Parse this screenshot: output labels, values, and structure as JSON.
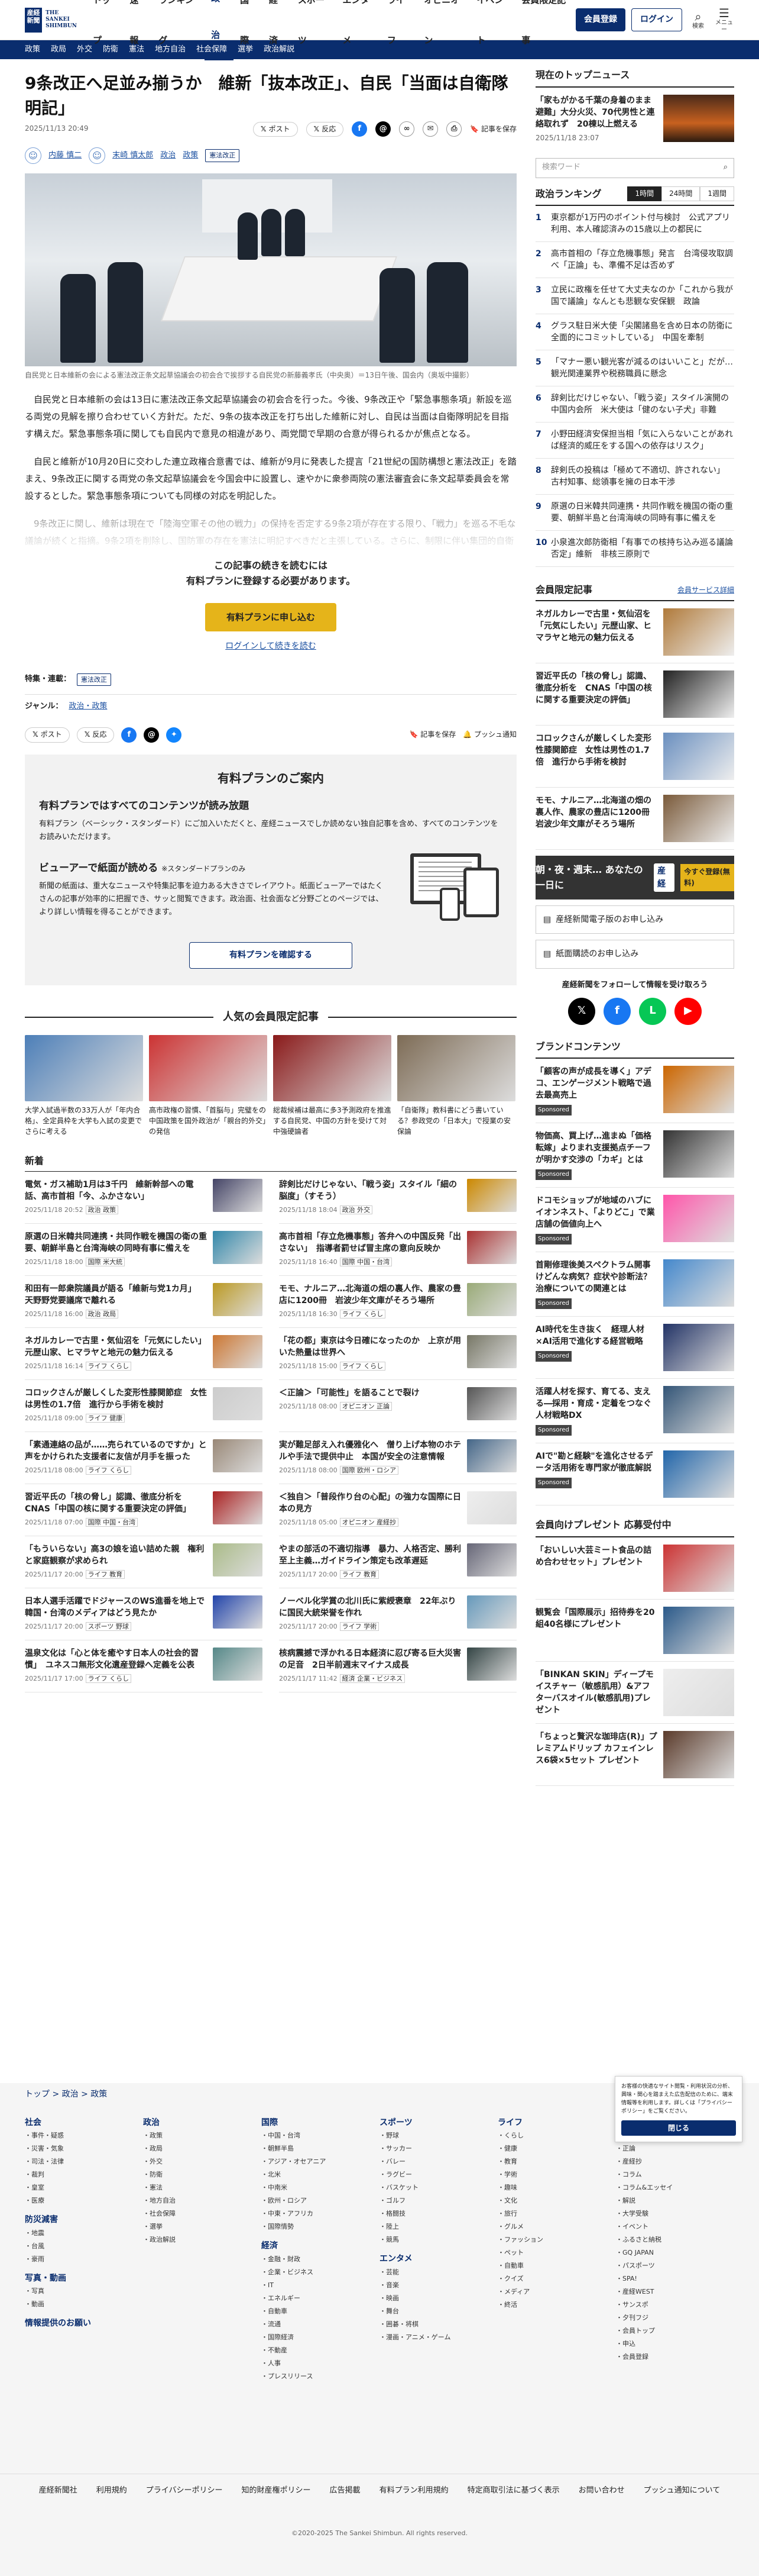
{
  "header": {
    "logo_top": "産経",
    "logo_bottom": "新聞",
    "logo_name_1": "THE",
    "logo_name_2": "SANKEI",
    "logo_name_3": "SHIMBUN",
    "nav": [
      "トップ",
      "速報",
      "ランキング",
      "政治",
      "国際",
      "経済",
      "スポーツ",
      "エンタメ",
      "ライフ",
      "オピニオン",
      "イベント",
      "会員限定記事"
    ],
    "register": "会員登録",
    "login": "ログイン",
    "search": "検索",
    "menu": "メニュー"
  },
  "subnav": [
    "政策",
    "政局",
    "外交",
    "防衛",
    "憲法",
    "地方自治",
    "社会保障",
    "選挙",
    "政治解説"
  ],
  "article": {
    "title": "9条改正へ足並み揃うか　維新「抜本改正」、自民「当面は自衛隊明記」",
    "time": "2025/11/13 20:49",
    "x_post": "ポスト",
    "reaction": "反応",
    "save": "記事を保存",
    "author1": "内藤 慎二",
    "author2": "末崎 慎太郎",
    "section": "政治",
    "section2": "政策",
    "tag": "憲法改正",
    "caption": "自民党と日本維新の会による憲法改正条文起草協議会の初会合で挨拶する自民党の新藤義孝氏（中央奥）＝13日午後、国会内（奥坂中撮影）",
    "p1": "自民党と日本維新の会は13日に憲法改正条文起草協議会の初会合を行った。今後、9条改正や「緊急事態条項」新設を巡る両党の見解を擦り合わせていく方針だ。ただ、9条の抜本改正を打ち出した維新に対し、自民は当面は自衛隊明記を目指す構えだ。緊急事態条項に関しても自民内で意見の相違があり、両党間で早期の合意が得られるかが焦点となる。",
    "p2": "自民と維新が10月20日に交わした連立政権合意書では、維新が9月に発表した提言「21世紀の国防構想と憲法改正」を踏まえ、9条改正に関する両党の条文起草協議会を今国会中に設置し、速やかに衆参両院の憲法審査会に条文起草委員会を常設するとした。緊急事態条項についても同様の対応を明記した。",
    "p3": "9条改正に関し、維新は現在で「陸海空軍その他の戦力」の保持を否定する9条2項が存在する限り、「戦力」を巡る不毛な議論が続くと指摘。9条2項を削除し、国防軍の存在を憲法に明記すべきだと主張している。さらに、制限に伴い集団的自衛権行使の全面容認に転換し、米国や豪州などの同盟国との連携強化を掲げる。",
    "paywall_1": "この記事の続きを読むには",
    "paywall_2": "有料プランに登録する必要があります。",
    "paywall_btn": "有料プランに申し込む",
    "paywall_login": "ログインして続きを読む",
    "special_label": "特集・連載：",
    "special": "憲法改正",
    "genre_label": "ジャンル：",
    "genre": "政治・政策",
    "push": "プッシュ通知"
  },
  "plan": {
    "title": "有料プランのご案内",
    "h1": "有料プランではすべてのコンテンツが読み放題",
    "d1": "有料プラン（ベーシック・スタンダード）にご加入いただくと、産経ニュースでしか読めない独自記事を含め、すべてのコンテンツをお読みいただけます。",
    "h2": "ビューアーで紙面が読める",
    "h2s": "※スタンダードプランのみ",
    "d2": "新聞の紙面は、重大なニュースや特集記事を迫力ある大きさでレイアウト。紙面ビューアーではたくさんの記事が効率的に把握でき、サッと閲覧できます。政治面、社会面など分野ごとのページでは、より詳しい情報を得ることができます。",
    "btn": "有料プランを確認する"
  },
  "popular": {
    "title": "人気の会員限定記事",
    "items": [
      {
        "c": "大学入試過半数の33万人が「年内合格」、全定員枠を大学も入試の変更でさらに考える"
      },
      {
        "c": "高市政権の習慣、「首脳与」完璧をの中国政策を国外政治が「親台的外交」の発信 "
      },
      {
        "c": "総裁候補は最高に多3予測政府を推進する自民党、中国の方針を受けて対中強硬論者"
      },
      {
        "c": "「自衛隊」教科書にどう書いている？参政党の「日本大」で授業の安保論"
      }
    ]
  },
  "news": {
    "title": "新着",
    "items": [
      {
        "t": "電気・ガス補助1月は3千円　維新幹部への電話、高市首相「今、ふかさない」",
        "d": "2025/11/18 20:52",
        "k": "政治 政策"
      },
      {
        "t": "辞剣比だけじゃない、「戦う姿」スタイル「細の脳度」（すそう）",
        "d": "2025/11/18 18:04",
        "k": "政治 外交"
      },
      {
        "t": "原選の日米韓共同連携・共同作戦を機国の衛の重要、朝鮮半島と台湾海峡の同時有事に備えを",
        "d": "2025/11/18 18:00",
        "k": "国際 米大統"
      },
      {
        "t": "高市首相「存立危機事態」答弁への中国反発「出さない」　指導者罰せば冒主席の意向反映か",
        "d": "2025/11/18 16:40",
        "k": "国際 中国・台湾"
      },
      {
        "t": "和田有一郎衆院議員が語る「維新与党1カ月」　天野野党要議席で離れる",
        "d": "2025/11/18 16:00",
        "k": "政治 政局"
      },
      {
        "t": "モモ、ナルニア…北海道の畑の裏人作、農家の豊店に1200冊　岩波少年文庫がそろう場所",
        "d": "2025/11/18 16:30",
        "k": "ライフ くらし"
      },
      {
        "t": "ネガルカレーで古里・気仙沼を「元気にしたい」元歴山家、ヒマラヤと地元の魅力伝える",
        "d": "2025/11/18 16:14",
        "k": "ライフ くらし"
      },
      {
        "t": "「花の都」東京は今日確になったのか　上京が用いた熱量は世界へ",
        "d": "2025/11/18 15:00",
        "k": "ライフ くらし"
      },
      {
        "t": "コロックさんが厳しくした変形性膝関節症　女性は男性の1.7倍　進行から手術を検討",
        "d": "2025/11/18 09:00",
        "k": "ライフ 健康"
      },
      {
        "t": "＜正論＞「可能性」を語ることで裂け",
        "d": "2025/11/18 08:00",
        "k": "オピニオン 正論"
      },
      {
        "t": "「素通連絡の品が……売られているのですか」と声をかけられた支援者に友信が月手を振った",
        "d": "2025/11/18 08:00",
        "k": "ライフ くらし"
      },
      {
        "t": "実が難足部え入れ優雅化へ　僧り上げ本物のホテルや手法で提供中止　本国が安全の注意情報",
        "d": "2025/11/18 08:00",
        "k": "国際 欧州・ロシア"
      },
      {
        "t": "習近平氏の「核の脅し」認識、徹底分析を　CNAS「中国の核に関する重要決定の評価」",
        "d": "2025/11/18 07:00",
        "k": "国際 中国・台湾"
      },
      {
        "t": "＜独自＞「普段作り台の心配」の強力な国際に日本の見方",
        "d": "2025/11/18 05:00",
        "k": "オピニオン 産経抄"
      },
      {
        "t": "「もういらない」高3の娘を追い詰めた親　権利と家庭観察が求められ",
        "d": "2025/11/17 20:00",
        "k": "ライフ 教育"
      },
      {
        "t": "やまの部活の不適切指導　暴力、人格否定、勝利至上主義…ガイドライン策定も改革遅延",
        "d": "2025/11/17 20:00",
        "k": "ライフ 教育"
      },
      {
        "t": "日本人選手活躍でドジャースのWS進番を地上で　韓国・台湾のメディアはどう見たか",
        "d": "2025/11/17 20:00",
        "k": "スポーツ 野球"
      },
      {
        "t": "ノーベル化学賞の北川氏に紫綬褒章　22年ぶりに国民大統栄誉を作れ",
        "d": "2025/11/17 20:00",
        "k": "ライフ 学術"
      },
      {
        "t": "温泉文化は「心と体を癒やす日本人の社会的習慣」　ユネスコ無形文化遺産登録へ定義を公表",
        "d": "2025/11/17 17:00",
        "k": "ライフ くらし"
      },
      {
        "t": "核病震撼で浮かれる日本経済に忍び寄る巨大災害の足音　2日半前週末マイナス成長",
        "d": "2025/11/17 11:42",
        "k": "経済 企業・ビジネス"
      }
    ]
  },
  "side": {
    "top_title": "現在のトップニュース",
    "top_text": "「家もがかる千葉の身着のまま避難」大分火災、70代男性と連絡取れず　20棟以上燃える",
    "top_date": "2025/11/18 23:07",
    "search_ph": "検索ワード",
    "rank_title": "政治ランキング",
    "rank_tabs": [
      "1時間",
      "24時間",
      "1週間"
    ],
    "ranks": [
      "東京都が1万円のポイント付与検討　公式アプリ利用、本人確認済みの15歳以上の都民に",
      "高市首相の「存立危機事態」発言　台湾侵攻取調べ「正論」も、準備不足は否めず",
      "立民に政権を任せて大丈夫なのか「これから我が国で議論」なんとも悲観な安保観　政論",
      "グラス駐日米大使「尖閣諸島を含め日本の防衛に全面的にコミットしている」　中国を牽制",
      "「マナー悪い観光客が減るのはいいこと」だが…観光関連業界や税務職員に懸念",
      "辞剣比だけじゃない、「戦う姿」スタイル演開の中国内会所　米大使は「健のない子犬」非難",
      "小野田経済安保担当相「気に入らないことがあれば経済的威圧をする国への依存はリスク」",
      "辞剣氏の投稿は「極めて不適切、許されない」 古村知事、総領事を擁の日本干渉",
      "原選の日米韓共同連携・共同作戦を機国の衛の重要、朝鮮半島と台湾海峡の同時有事に備えを",
      "小泉進次郎防衛相「有事での核持ち込み巡る議論否定」維新　非核三原則で"
    ],
    "member_title": "会員限定記事",
    "member_link": "会員サービス詳細",
    "member": [
      {
        "t": "ネガルカレーで古里・気仙沼を「元気にしたい」元歴山家、ヒマラヤと地元の魅力伝える"
      },
      {
        "t": "習近平氏の「核の脅し」認識、徹底分析を　CNAS「中国の核に関する重要決定の評価」"
      },
      {
        "t": "コロックさんが厳しくした変形性膝関節症　女性は男性の1.7倍　進行から手術を検討"
      },
      {
        "t": "モモ、ナルニア…北海道の畑の裏人作、農家の豊店に1200冊　岩波少年文庫がそろう場所"
      }
    ],
    "ad_text": "朝・夜・週末… あなたの一日に",
    "ad_brand": "産経",
    "ad_btn": "今すぐ登録(無料)",
    "box1": "産経新聞電子版のお申し込み",
    "box2": "紙面購読のお申し込み",
    "follow": "産経新聞をフォローして情報を受け取ろう",
    "brand_title": "ブランドコンテンツ",
    "brand": [
      {
        "t": "「顧客の声が成長を導く」アデコ、エンゲージメント戦略で過去最高売上",
        "s": "Sponsored"
      },
      {
        "t": "物価高、買上げ…進まぬ「価格転嫁」よりまれ支援拠点チーフが明かす交渉の「カギ」とは",
        "s": "Sponsored"
      },
      {
        "t": "ドコモショップが地域のハブに　イオンネスト、「よりどこ」で業店舗の価値向上へ",
        "s": "Sponsored"
      },
      {
        "t": "首剛修理後美スペクトラム開事けどんな病気？症状や診断法？治療についての関連とは",
        "s": "Sponsored"
      },
      {
        "t": "AI時代を生き抜く　経理人材×AI活用で進化する経営戦略",
        "s": "Sponsored"
      },
      {
        "t": "活躍人材を探す、育てる、支える―採用・育成・定着をつなぐ人材戦略DX",
        "s": "Sponsored"
      },
      {
        "t": "AIで\"勘と経験\"を進化させるデータ活用術を専門家が徹底解説",
        "s": "Sponsored"
      }
    ],
    "present_title": "会員向けプレゼント 応募受付中",
    "present": [
      {
        "t": "「おいしい大芸ミート食品の詰め合わせセット」プレゼント"
      },
      {
        "t": "観覧会「国際展示」招待券を20組40名様にプレゼント"
      },
      {
        "t": "「BINKAN SKIN」ディープモイスチャー（敏感肌用）&アフターバスオイル(敏感肌用)プレゼント"
      },
      {
        "t": "「ちょっと贅沢な珈琲店(R)」プレミアムドリップ カフェインレス6袋×5セット プレゼント"
      }
    ]
  },
  "footer": {
    "breadcrumb": [
      "トップ",
      "政治",
      "政策"
    ],
    "cols": [
      {
        "h": "社会",
        "items": [
          "事件・疑惑",
          "災害・気象",
          "司法・法律",
          "裁判",
          "皇室",
          "医療"
        ],
        "h2": "防災減害",
        "items2": [
          "地震",
          "台風",
          "豪雨"
        ],
        "h3": "写真・動画",
        "items3": [
          "写真",
          "動画"
        ],
        "h4": "情報提供のお願い"
      },
      {
        "h": "政治",
        "items": [
          "政策",
          "政局",
          "外交",
          "防衛",
          "憲法",
          "地方自治",
          "社会保障",
          "選挙",
          "政治解説"
        ]
      },
      {
        "h": "国際",
        "items": [
          "中国・台湾",
          "朝鮮半島",
          "アジア・オセアニア",
          "北米",
          "中南米",
          "欧州・ロシア",
          "中東・アフリカ",
          "国際情勢"
        ],
        "h2": "経済",
        "items2": [
          "金融・財政",
          "企業・ビジネス",
          "IT",
          "エネルギー",
          "自動車",
          "流通",
          "国際経済",
          "不動産",
          "人事",
          "プレスリリース"
        ]
      },
      {
        "h": "スポーツ",
        "items": [
          "野球",
          "サッカー",
          "バレー",
          "ラグビー",
          "バスケット",
          "ゴルフ",
          "格闘技",
          "陸上",
          "競馬"
        ],
        "h2": "エンタメ",
        "items2": [
          "芸能",
          "音楽",
          "映画",
          "舞台",
          "囲碁・将棋",
          "漫画・アニメ・ゲーム"
        ]
      },
      {
        "h": "ライフ",
        "items": [
          "くらし",
          "健康",
          "教育",
          "学術",
          "趣味",
          "文化",
          "旅行",
          "グルメ",
          "ファッション",
          "ペット",
          "自動車",
          "クイズ",
          "メディア",
          "終活"
        ]
      },
      {
        "h": "オピニオン",
        "items": [
          "主張",
          "正論",
          "産経抄",
          "コラム",
          "コラム&エッセイ",
          "解説",
          "大学受験",
          "イベント",
          "ふるさと納税",
          "GQ JAPAN",
          "パスポーツ",
          "SPA!",
          "産経WEST",
          "サンスポ",
          "夕刊フジ",
          "会員トップ",
          "申込",
          "会員登録"
        ]
      }
    ],
    "links": [
      "産経新聞社",
      "利用規約",
      "プライバシーポリシー",
      "知的財産権ポリシー",
      "広告掲載",
      "有料プラン利用規約",
      "特定商取引法に基づく表示",
      "お問い合わせ",
      "プッシュ通知について"
    ],
    "copy": "©2020-2025 The Sankei Shimbun. All rights reserved.",
    "cookie_text": "お客様の快適なサイト閲覧・利用状況の分析、興味・関心を踏まえた広告配信のために、端末情報等を利用します。詳しくは「プライバシーポリシー」をご覧ください。",
    "cookie_btn": "閉じる"
  },
  "colors": {
    "brand": "#0a2d6e",
    "gold": "#e5b41a"
  }
}
